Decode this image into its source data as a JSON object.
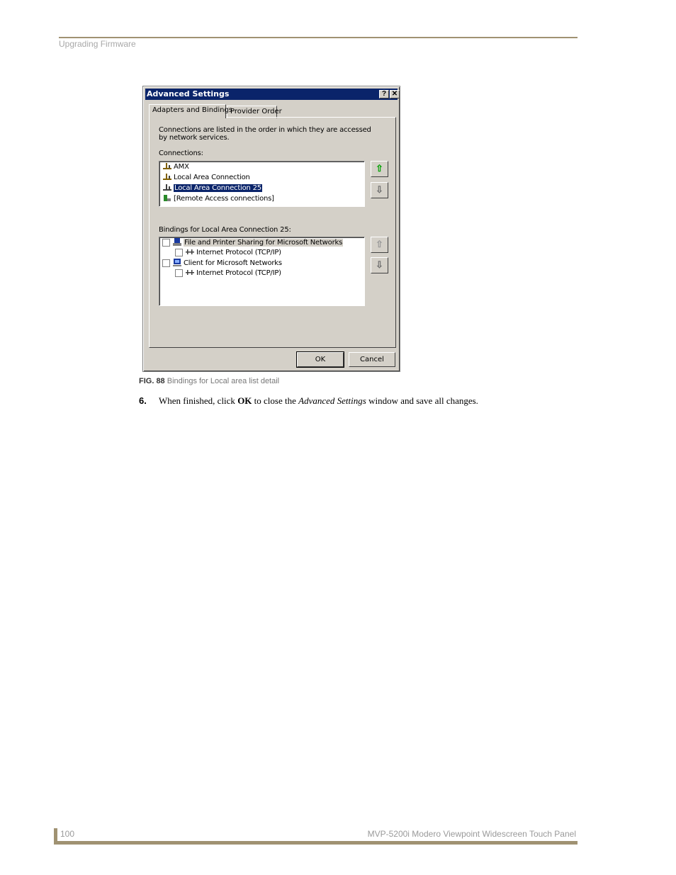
{
  "header": {
    "section": "Upgrading Firmware"
  },
  "footer": {
    "page_number": "100",
    "title": "MVP-5200i Modero Viewpoint Widescreen Touch Panel"
  },
  "dialog": {
    "title": "Advanced Settings",
    "help_label": "?",
    "close_label": "✕",
    "tabs": [
      {
        "label": "Adapters and Bindings",
        "active": true
      },
      {
        "label": "Provider Order",
        "active": false
      }
    ],
    "description": "Connections are listed in the order in which they are accessed by network services.",
    "connections_label": "Connections:",
    "connections": [
      {
        "label": "AMX",
        "icon": "network-adapter-icon"
      },
      {
        "label": "Local Area Connection",
        "icon": "network-adapter-icon"
      },
      {
        "label": "Local Area Connection 25",
        "icon": "network-adapter-icon",
        "selected": true
      },
      {
        "label": "[Remote Access connections]",
        "icon": "remote-access-icon"
      }
    ],
    "bindings_label": "Bindings for Local Area Connection 25:",
    "bindings": [
      {
        "label": "File and Printer Sharing for Microsoft Networks",
        "level": 0,
        "icon": "file-printer-sharing-icon"
      },
      {
        "label": "Internet Protocol (TCP/IP)",
        "level": 1,
        "icon": "protocol-icon"
      },
      {
        "label": "Client for Microsoft Networks",
        "level": 0,
        "icon": "network-client-icon"
      },
      {
        "label": "Internet Protocol (TCP/IP)",
        "level": 1,
        "icon": "protocol-icon"
      }
    ],
    "ok_label": "OK",
    "cancel_label": "Cancel"
  },
  "figure": {
    "label": "FIG. 88",
    "caption": "Bindings for Local area list detail"
  },
  "step": {
    "number": "6.",
    "text_before": "When finished, click ",
    "bold": "OK",
    "text_middle": " to close the ",
    "italic": "Advanced Settings",
    "text_after": " window and save all changes."
  },
  "colors": {
    "accent_rule": "#a09272",
    "title_bar": "#0a246a",
    "dialog_face": "#d4d0c8"
  }
}
